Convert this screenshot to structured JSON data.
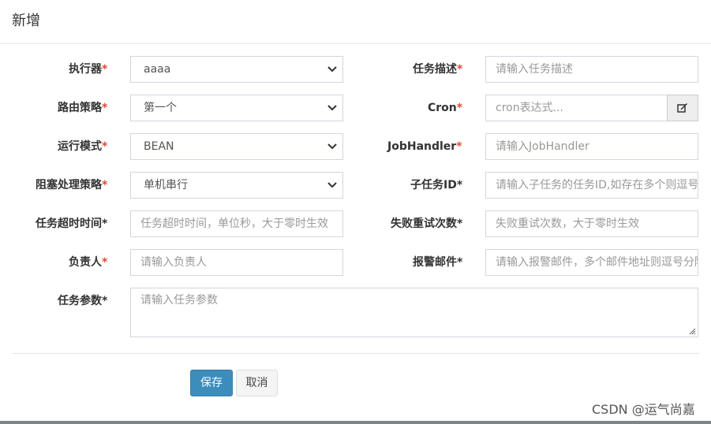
{
  "modal": {
    "title": "新增"
  },
  "form": {
    "executor": {
      "label": "执行器",
      "value": "aaaa"
    },
    "job_desc": {
      "label": "任务描述",
      "placeholder": "请输入任务描述"
    },
    "route_strategy": {
      "label": "路由策略",
      "value": "第一个"
    },
    "cron": {
      "label": "Cron",
      "placeholder": "cron表达式...",
      "addon_icon": "edit-icon"
    },
    "glue_type": {
      "label": "运行模式",
      "value": "BEAN"
    },
    "job_handler": {
      "label": "JobHandler",
      "placeholder": "请输入JobHandler"
    },
    "block_strategy": {
      "label": "阻塞处理策略",
      "value": "单机串行"
    },
    "child_job_id": {
      "label": "子任务ID",
      "placeholder": "请输入子任务的任务ID,如存在多个则逗号分隔"
    },
    "timeout": {
      "label": "任务超时时间",
      "placeholder": "任务超时时间，单位秒，大于零时生效"
    },
    "fail_retry": {
      "label": "失败重试次数",
      "placeholder": "失败重试次数，大于零时生效"
    },
    "author": {
      "label": "负责人",
      "placeholder": "请输入负责人"
    },
    "alarm_email": {
      "label": "报警邮件",
      "placeholder": "请输入报警邮件，多个邮件地址则逗号分隔"
    },
    "params": {
      "label": "任务参数",
      "placeholder": "请输入任务参数"
    },
    "required_mark": "*"
  },
  "buttons": {
    "save": "保存",
    "cancel": "取消"
  },
  "watermark": "CSDN @运气尚嘉",
  "colors": {
    "primary": "#3c8dbc",
    "required": "#dd4b39",
    "addon_bg": "#eeeeee"
  }
}
